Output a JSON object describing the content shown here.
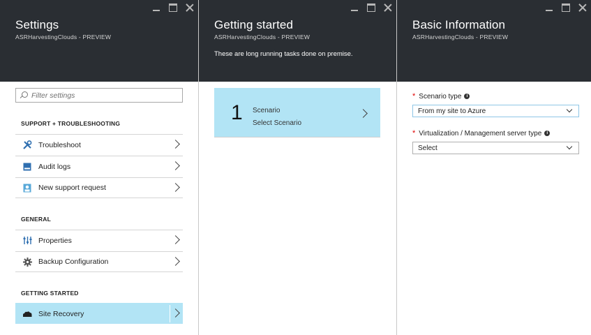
{
  "settings": {
    "title": "Settings",
    "subtitle": "ASRHarvestingClouds - PREVIEW",
    "search_placeholder": "Filter settings",
    "sections": [
      {
        "header": "SUPPORT + TROUBLESHOOTING",
        "items": [
          {
            "label": "Troubleshoot",
            "icon": "wrench-icon"
          },
          {
            "label": "Audit logs",
            "icon": "audit-log-icon"
          },
          {
            "label": "New support request",
            "icon": "support-person-icon"
          }
        ]
      },
      {
        "header": "GENERAL",
        "items": [
          {
            "label": "Properties",
            "icon": "sliders-icon"
          },
          {
            "label": "Backup Configuration",
            "icon": "gear-icon"
          }
        ]
      },
      {
        "header": "GETTING STARTED",
        "items": [
          {
            "label": "Site Recovery",
            "icon": "cloud-icon",
            "selected": true
          }
        ]
      }
    ]
  },
  "getting_started": {
    "title": "Getting started",
    "subtitle": "ASRHarvestingClouds - PREVIEW",
    "description": "These are long running tasks done on premise.",
    "step": {
      "number": "1",
      "title": "Scenario",
      "subtitle": "Select Scenario"
    }
  },
  "basic_info": {
    "title": "Basic Information",
    "subtitle": "ASRHarvestingClouds - PREVIEW",
    "fields": [
      {
        "label": "Scenario type",
        "required": "*",
        "value": "From my site to Azure"
      },
      {
        "label": "Virtualization / Management server type",
        "required": "*",
        "value": "Select"
      }
    ]
  },
  "colors": {
    "header_bg": "#2a2e33",
    "selected_bg": "#b2e4f5",
    "required": "#e00000"
  }
}
